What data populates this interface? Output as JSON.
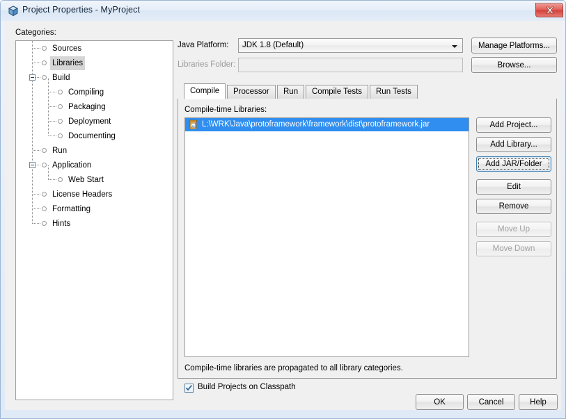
{
  "window": {
    "title": "Project Properties - MyProject",
    "icon": "cube-icon",
    "close_label": "x",
    "accent_selection": "#2f8ef0",
    "close_color": "#d2413a"
  },
  "categories": {
    "label": "Categories:",
    "items": [
      {
        "label": "Sources",
        "depth": 0,
        "expander": "none",
        "selected": false
      },
      {
        "label": "Libraries",
        "depth": 0,
        "expander": "none",
        "selected": true
      },
      {
        "label": "Build",
        "depth": 0,
        "expander": "collapse",
        "selected": false
      },
      {
        "label": "Compiling",
        "depth": 1,
        "expander": "none",
        "selected": false
      },
      {
        "label": "Packaging",
        "depth": 1,
        "expander": "none",
        "selected": false
      },
      {
        "label": "Deployment",
        "depth": 1,
        "expander": "none",
        "selected": false
      },
      {
        "label": "Documenting",
        "depth": 1,
        "expander": "none",
        "selected": false
      },
      {
        "label": "Run",
        "depth": 0,
        "expander": "none",
        "selected": false
      },
      {
        "label": "Application",
        "depth": 0,
        "expander": "collapse",
        "selected": false
      },
      {
        "label": "Web Start",
        "depth": 1,
        "expander": "none",
        "selected": false
      },
      {
        "label": "License Headers",
        "depth": 0,
        "expander": "none",
        "selected": false
      },
      {
        "label": "Formatting",
        "depth": 0,
        "expander": "none",
        "selected": false
      },
      {
        "label": "Hints",
        "depth": 0,
        "expander": "none",
        "selected": false
      }
    ]
  },
  "platform": {
    "java_platform_label": "Java Platform:",
    "java_platform_value": "JDK 1.8 (Default)",
    "manage_platforms_label": "Manage Platforms...",
    "libraries_folder_label": "Libraries Folder:",
    "libraries_folder_value": "",
    "libraries_folder_placeholder": "",
    "browse_label": "Browse..."
  },
  "tabs": [
    {
      "label": "Compile",
      "active": true
    },
    {
      "label": "Processor",
      "active": false
    },
    {
      "label": "Run",
      "active": false
    },
    {
      "label": "Compile Tests",
      "active": false
    },
    {
      "label": "Run Tests",
      "active": false
    }
  ],
  "compile_panel": {
    "list_title": "Compile-time Libraries:",
    "entries": [
      {
        "icon": "jar-icon",
        "text": "L:\\WRK\\Java\\protoframework\\framework\\dist\\protoframework.jar",
        "selected": true
      }
    ],
    "note": "Compile-time libraries are propagated to all library categories.",
    "side_buttons": [
      {
        "label": "Add Project...",
        "enabled": true,
        "focused": false
      },
      {
        "label": "Add Library...",
        "enabled": true,
        "focused": false
      },
      {
        "label": "Add JAR/Folder",
        "enabled": true,
        "focused": true
      },
      {
        "label": "Edit",
        "enabled": true,
        "focused": false
      },
      {
        "label": "Remove",
        "enabled": true,
        "focused": false
      },
      {
        "label": "Move Up",
        "enabled": false,
        "focused": false
      },
      {
        "label": "Move Down",
        "enabled": false,
        "focused": false
      }
    ]
  },
  "classpath_checkbox": {
    "label": "Build Projects on Classpath",
    "checked": true
  },
  "footer": {
    "ok_label": "OK",
    "cancel_label": "Cancel",
    "help_label": "Help"
  }
}
